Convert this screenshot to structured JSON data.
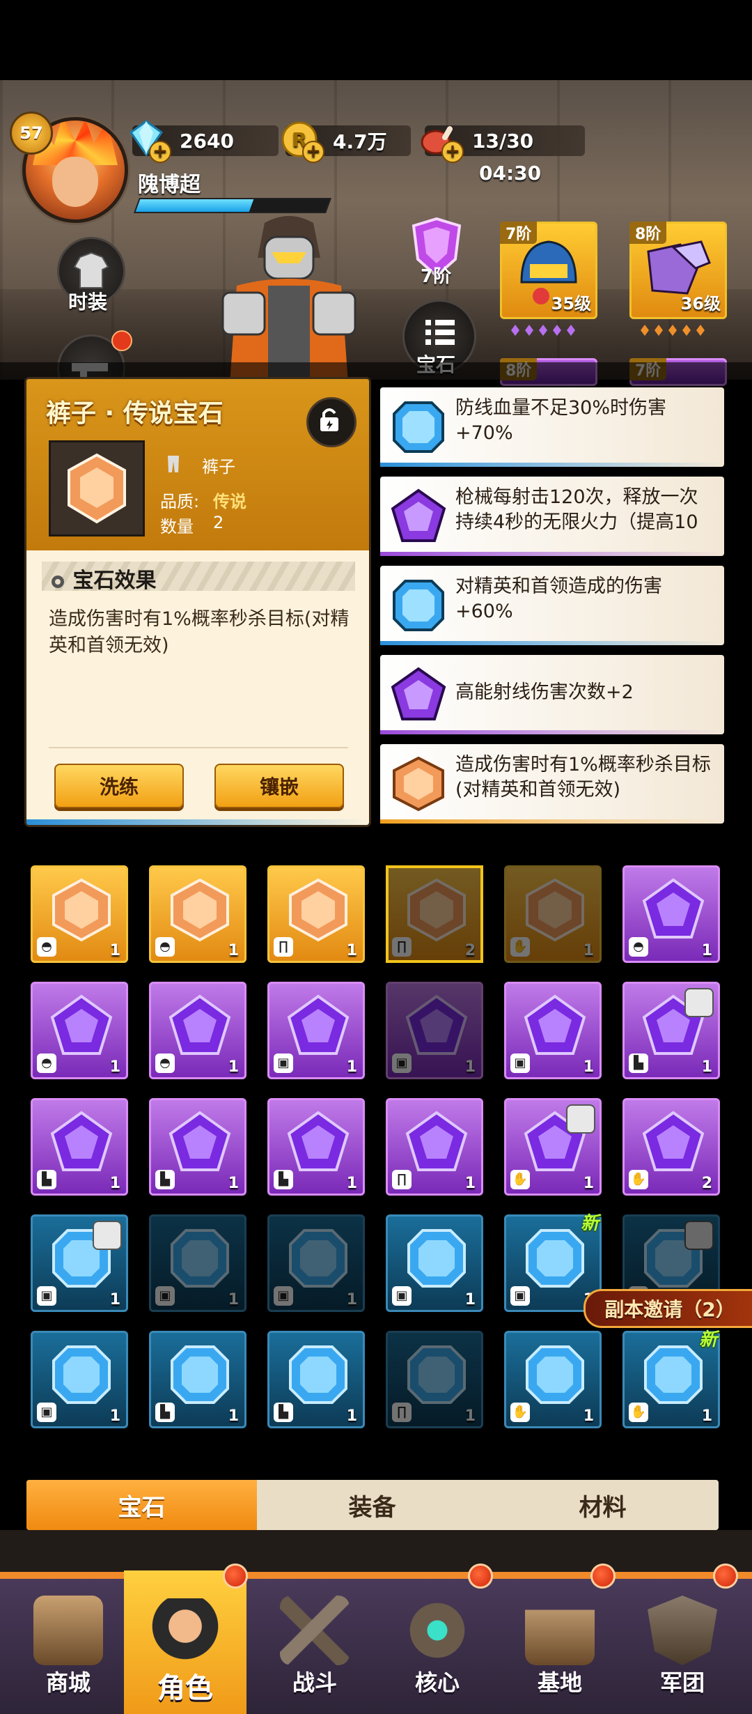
{
  "player": {
    "level": "57",
    "name": "隗博超",
    "xp_fraction": 0.6
  },
  "resources": {
    "gems": "2640",
    "coins": "4.7万",
    "stamina": "13/30",
    "stamina_timer": "04:30"
  },
  "side_buttons": {
    "outfit": "时装"
  },
  "rank": {
    "label": "7阶"
  },
  "gem_button": {
    "label": "宝石"
  },
  "equipment": [
    {
      "tier": "7阶",
      "level": "35级",
      "rarity": "purple",
      "gems": 5
    },
    {
      "tier": "8阶",
      "level": "36级",
      "rarity": "orange",
      "gems": 5
    },
    {
      "tier": "8阶",
      "level": "",
      "rarity": "purple"
    },
    {
      "tier": "7阶",
      "level": "",
      "rarity": "purple"
    }
  ],
  "detail": {
    "title": "裤子 · 传说宝石",
    "slot_name": "裤子",
    "quality_label": "品质:",
    "quality_value": "传说",
    "count_label": "数量",
    "count_value": "2",
    "effect_title": "宝石效果",
    "effect_text": "造成伤害时有1%概率秒杀目标(对精英和首领无效)",
    "refine_button": "洗练",
    "inlay_button": "镶嵌"
  },
  "effects": [
    {
      "color": "blue",
      "text": "防线血量不足30%时伤害+70%"
    },
    {
      "color": "purple",
      "text": "枪械每射击120次，释放一次持续4秒的无限火力（提高10"
    },
    {
      "color": "blue",
      "text": "对精英和首领造成的伤害+60%"
    },
    {
      "color": "purple",
      "text": "高能射线伤害次数+2"
    },
    {
      "color": "orange",
      "text": "造成伤害时有1%概率秒杀目标(对精英和首领无效)"
    }
  ],
  "inventory": [
    {
      "color": "orange",
      "slot": "helmet",
      "count": "1"
    },
    {
      "color": "orange",
      "slot": "helmet",
      "count": "1"
    },
    {
      "color": "orange",
      "slot": "pants",
      "count": "1"
    },
    {
      "color": "orange",
      "slot": "pants",
      "count": "2",
      "dim": true,
      "selected": true
    },
    {
      "color": "orange",
      "slot": "glove",
      "count": "1",
      "dim": true
    },
    {
      "color": "purple",
      "slot": "helmet",
      "count": "1"
    },
    {
      "color": "purple",
      "slot": "helmet",
      "count": "1"
    },
    {
      "color": "purple",
      "slot": "helmet",
      "count": "1"
    },
    {
      "color": "purple",
      "slot": "armor",
      "count": "1"
    },
    {
      "color": "purple",
      "slot": "armor",
      "count": "1",
      "dim": true
    },
    {
      "color": "purple",
      "slot": "armor",
      "count": "1"
    },
    {
      "color": "purple",
      "slot": "boot",
      "count": "1",
      "locked": true
    },
    {
      "color": "purple",
      "slot": "boot",
      "count": "1"
    },
    {
      "color": "purple",
      "slot": "boot",
      "count": "1"
    },
    {
      "color": "purple",
      "slot": "boot",
      "count": "1"
    },
    {
      "color": "purple",
      "slot": "pants",
      "count": "1"
    },
    {
      "color": "purple",
      "slot": "glove",
      "count": "1",
      "locked": true
    },
    {
      "color": "purple",
      "slot": "glove",
      "count": "2"
    },
    {
      "color": "blue",
      "slot": "armor",
      "count": "1",
      "locked": true
    },
    {
      "color": "blue",
      "slot": "armor",
      "count": "1",
      "dim": true
    },
    {
      "color": "blue",
      "slot": "armor",
      "count": "1",
      "dim": true
    },
    {
      "color": "blue",
      "slot": "armor",
      "count": "1"
    },
    {
      "color": "blue",
      "slot": "armor",
      "count": "1",
      "new": true
    },
    {
      "color": "blue",
      "slot": "armor",
      "count": "1",
      "dim": true,
      "locked": true
    },
    {
      "color": "blue",
      "slot": "armor",
      "count": "1"
    },
    {
      "color": "blue",
      "slot": "boot",
      "count": "1"
    },
    {
      "color": "blue",
      "slot": "boot",
      "count": "1"
    },
    {
      "color": "blue",
      "slot": "pants",
      "count": "1",
      "dim": true
    },
    {
      "color": "blue",
      "slot": "glove",
      "count": "1"
    },
    {
      "color": "blue",
      "slot": "glove",
      "count": "1",
      "new": true
    }
  ],
  "new_tag": "新",
  "invite_banner": "副本邀请（2）",
  "tabs": [
    {
      "label": "宝石",
      "active": true
    },
    {
      "label": "装备"
    },
    {
      "label": "材料"
    }
  ],
  "nav": [
    {
      "label": "商城",
      "icon": "shop-icon"
    },
    {
      "label": "角色",
      "icon": "character-icon",
      "active": true
    },
    {
      "label": "战斗",
      "icon": "battle-icon"
    },
    {
      "label": "核心",
      "icon": "core-icon"
    },
    {
      "label": "基地",
      "icon": "base-icon"
    },
    {
      "label": "军团",
      "icon": "legion-icon"
    }
  ],
  "colors": {
    "orange": "#f0a020",
    "purple": "#9a4ad8",
    "blue": "#2a8fd8",
    "accent": "#f6c23c"
  }
}
